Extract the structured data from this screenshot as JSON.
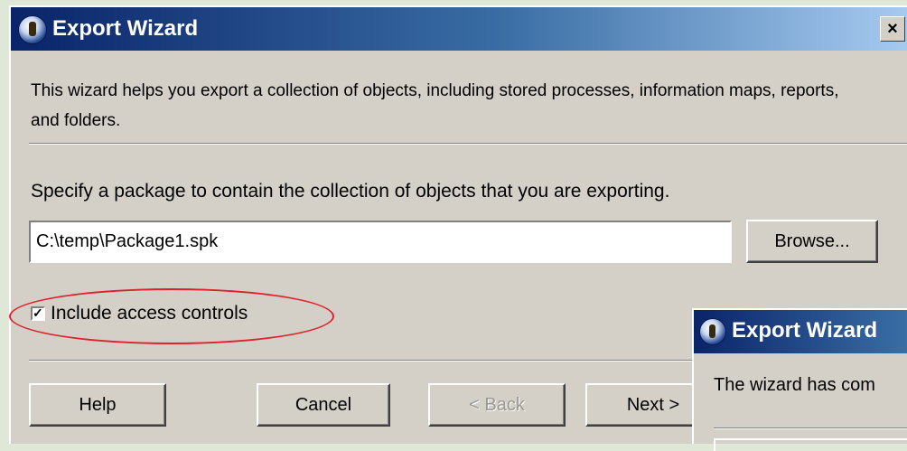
{
  "main_dialog": {
    "title": "Export Wizard",
    "close_glyph": "×",
    "intro": "This wizard helps you export a collection of objects, including stored processes, information maps, reports, and folders.",
    "specify_label": "Specify a package to contain the collection of objects that you are exporting.",
    "package_path": "C:\\temp\\Package1.spk",
    "browse_label": "Browse...",
    "include_access_controls": {
      "label": "Include access controls",
      "checked": true,
      "mark": "✓"
    },
    "buttons": {
      "help": "Help",
      "cancel": "Cancel",
      "back": "< Back",
      "next": "Next >"
    }
  },
  "second_dialog": {
    "title": "Export Wizard",
    "message": "The wizard has com"
  },
  "colors": {
    "title_bar_start": "#0a246a",
    "dialog_face": "#d4d0c8",
    "highlight_ellipse": "#e0202c",
    "desktop": "#dfe8d6"
  },
  "icons": {
    "title_icon": "wizard-icon",
    "close": "close-icon",
    "checkbox": "checkbox-checked-icon"
  }
}
